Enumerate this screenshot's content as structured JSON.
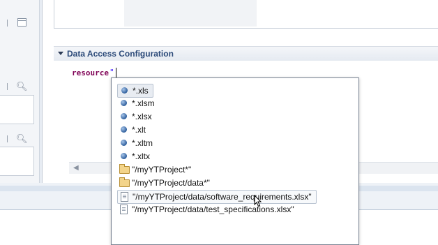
{
  "section": {
    "title": "Data Access Configuration"
  },
  "editor": {
    "keyword": "resource",
    "string_open": "\""
  },
  "completion": {
    "items": [
      {
        "label": "*.xls",
        "icon": "extension-icon"
      },
      {
        "label": "*.xlsm",
        "icon": "extension-icon"
      },
      {
        "label": "*.xlsx",
        "icon": "extension-icon"
      },
      {
        "label": "*.xlt",
        "icon": "extension-icon"
      },
      {
        "label": "*.xltm",
        "icon": "extension-icon"
      },
      {
        "label": "*.xltx",
        "icon": "extension-icon"
      },
      {
        "label": "\"/myYTProject*\"",
        "icon": "folder-icon"
      },
      {
        "label": "\"/myYTProject/data*\"",
        "icon": "folder-icon"
      },
      {
        "label": "\"/myYTProject/data/software_requirements.xlsx\"",
        "icon": "file-icon"
      },
      {
        "label": "\"/myYTProject/data/test_specifications.xlsx\"",
        "icon": "file-icon"
      }
    ],
    "selected_index": 0,
    "hover_index": 8
  },
  "colors": {
    "keyword": "#7f0055",
    "section_title": "#2c4a79",
    "popup_border": "#7a8494"
  }
}
